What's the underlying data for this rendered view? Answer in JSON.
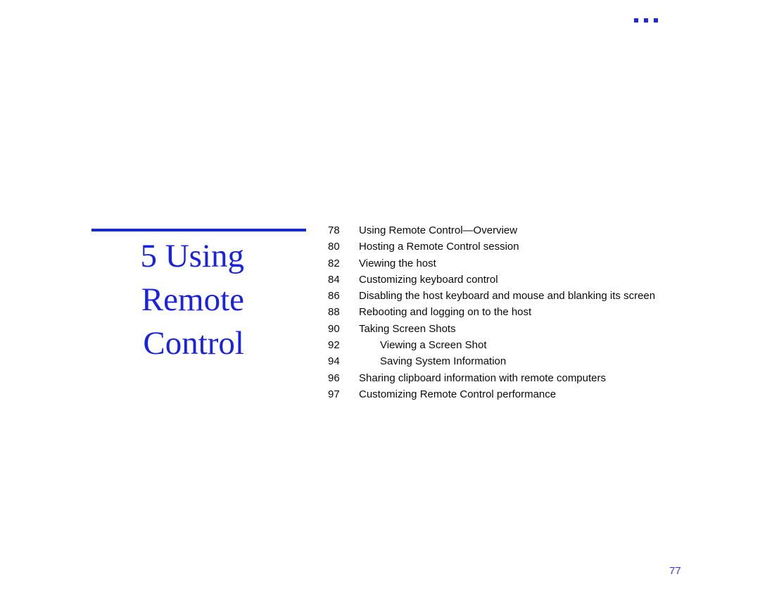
{
  "page": {
    "folio": "77",
    "background_color": "#ffffff",
    "accent_color": "#1a23dd",
    "rule_color": "#1328e0",
    "body_text_color": "#0a0a0a"
  },
  "decoration": {
    "corner_dots": {
      "icon": "three-dots-marker",
      "count": 3,
      "color": "#1d28de"
    }
  },
  "chapter": {
    "number": "5",
    "title": "Using Remote Control",
    "heading_line_1": "5 Using",
    "heading_line_2": "Remote",
    "heading_line_3": "Control"
  },
  "toc": {
    "entries": [
      {
        "page": "78",
        "label": "Using Remote Control—Overview",
        "level": 1
      },
      {
        "page": "80",
        "label": "Hosting a Remote Control session",
        "level": 1
      },
      {
        "page": "82",
        "label": "Viewing the host",
        "level": 1
      },
      {
        "page": "84",
        "label": "Customizing keyboard control",
        "level": 1
      },
      {
        "page": "86",
        "label": "Disabling the host keyboard and mouse and blanking its screen",
        "level": 1
      },
      {
        "page": "88",
        "label": "Rebooting and logging on to the host",
        "level": 1
      },
      {
        "page": "90",
        "label": "Taking Screen Shots",
        "level": 1
      },
      {
        "page": "92",
        "label": "Viewing a Screen Shot",
        "level": 2
      },
      {
        "page": "94",
        "label": "Saving System Information",
        "level": 2
      },
      {
        "page": "96",
        "label": "Sharing clipboard information with remote computers",
        "level": 1
      },
      {
        "page": "97",
        "label": "Customizing Remote Control performance",
        "level": 1
      }
    ]
  }
}
